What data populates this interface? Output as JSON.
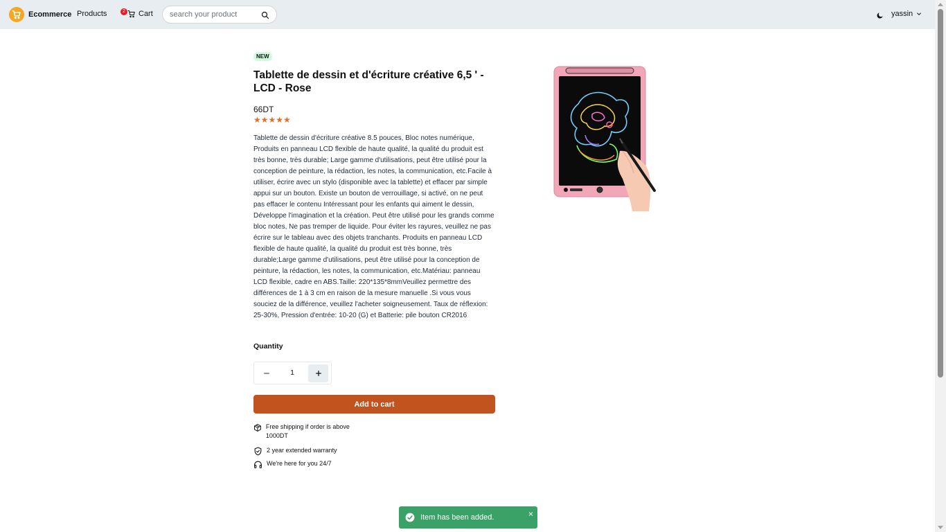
{
  "navbar": {
    "brand": "Ecommerce",
    "products_label": "Products",
    "cart_label": "Cart",
    "cart_count": "2",
    "search_placeholder": "search your product",
    "username": "yassin"
  },
  "product": {
    "badge": "NEW",
    "title": "Tablette de dessin et d'écriture créative 6,5 ' - LCD - Rose",
    "price": "66DT",
    "rating": 5,
    "stars": "★★★★★",
    "description": "Tablette de dessin d'écriture créative 8.5 pouces, Bloc notes numérique, Produits en panneau LCD flexible de haute qualité, la qualité du produit est très bonne, très durable; Large gamme d'utilisations, peut être utilisé pour la conception de peinture, la rédaction, les notes, la communication, etc.Facile à utiliser, écrire avec un stylo (disponible avec la tablette) et effacer par simple appui sur un bouton. Existe un bouton de verrouillage, si activé, on ne peut pas effacer le contenu Intéressant pour les enfants qui aiment le dessin, Développe l'imagination et la création. Peut être utilisé pour les grands comme bloc notes, Ne pas tremper de liquide. Pour éviter les rayures, veuillez ne pas écrire sur le tableau avec des objets tranchants. Produits en panneau LCD flexible de haute qualité, la qualité du produit est très bonne, très durable;Large gamme d'utilisations, peut être utilisé pour la conception de peinture, la rédaction, les notes, la communication, etc.Matériau: panneau LCD flexible, cadre en ABS.Taille: 220*135*8mmVeuillez permettre des différences de 1 à 3 cm en raison de la mesure manuelle .Si vous vous souciez de la différence, veuillez l'acheter soigneusement. Taux de réflexion: 25-30%, Pression d'entrée: 10-20 (G) et Batterie: pile bouton CR2016",
    "quantity_label": "Quantity",
    "quantity": "1",
    "add_to_cart": "Add to cart",
    "features": [
      {
        "icon": "package-icon",
        "text": "Free shipping if order is above 1000DT"
      },
      {
        "icon": "shield-check-icon",
        "text": "2 year extended warranty"
      },
      {
        "icon": "headphones-icon",
        "text": "We're here for you 24/7"
      }
    ]
  },
  "toast": {
    "message": "Item has been added.",
    "close": "×"
  },
  "colors": {
    "navbar_bg": "#e8edf2",
    "accent": "#c1531f",
    "stars": "#e06d2b",
    "toast_bg": "#3aa266",
    "logo": "#f5a623",
    "badge_bg": "#d1fadf"
  }
}
